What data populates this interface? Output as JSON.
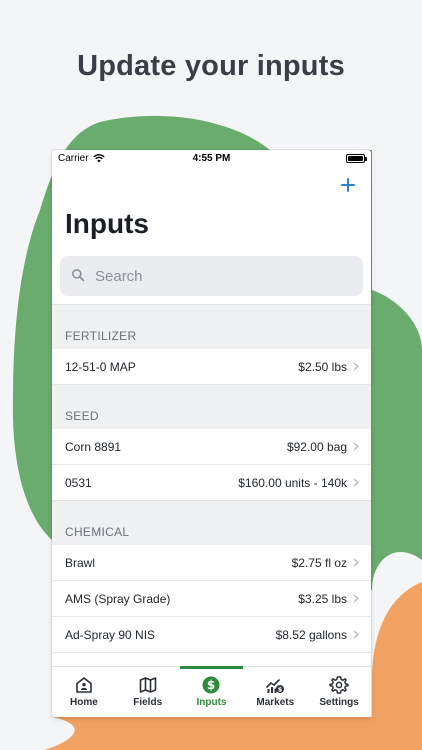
{
  "headline": "Update your inputs",
  "status_bar": {
    "carrier": "Carrier",
    "time": "4:55 PM"
  },
  "page": {
    "title": "Inputs"
  },
  "search": {
    "placeholder": "Search"
  },
  "colors": {
    "accent_blue": "#2f7fd6",
    "active_green": "#2f8b3c",
    "blob_green": "#6aab6e",
    "blob_orange": "#f1a262"
  },
  "sections": [
    {
      "title": "FERTILIZER",
      "items": [
        {
          "name": "12-51-0 MAP",
          "price": "$2.50 lbs"
        }
      ]
    },
    {
      "title": "SEED",
      "items": [
        {
          "name": "Corn 8891",
          "price": "$92.00 bag"
        },
        {
          "name": "0531",
          "price": "$160.00 units - 140k"
        }
      ]
    },
    {
      "title": "CHEMICAL",
      "items": [
        {
          "name": "Brawl",
          "price": "$2.75 fl oz"
        },
        {
          "name": "AMS (Spray Grade)",
          "price": "$3.25 lbs"
        },
        {
          "name": "Ad-Spray 90 NIS",
          "price": "$8.52 gallons"
        }
      ]
    }
  ],
  "tabs": [
    {
      "label": "Home",
      "icon": "home-icon"
    },
    {
      "label": "Fields",
      "icon": "map-icon"
    },
    {
      "label": "Inputs",
      "icon": "dollar-icon",
      "active": true
    },
    {
      "label": "Markets",
      "icon": "markets-icon"
    },
    {
      "label": "Settings",
      "icon": "gear-icon"
    }
  ]
}
